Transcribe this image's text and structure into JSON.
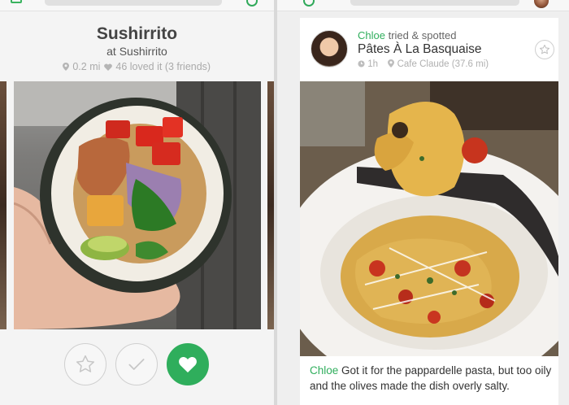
{
  "left_card": {
    "place_name": "Sushirrito",
    "place_sub": "at Sushirrito",
    "distance": "0.2 mi",
    "loved": "46 loved it (3 friends)"
  },
  "right_card": {
    "user": "Chloe",
    "action": "tried & spotted",
    "dish": "Pâtes À La Basquaise",
    "time": "1h",
    "location": "Cafe Claude (37.6 mi)",
    "comment_user": "Chloe",
    "comment_text": "Got it for the pappardelle pasta, but too oily and the olives made the dish overly salty."
  },
  "icons": {
    "star": "star-icon",
    "check": "check-icon",
    "heart": "heart-icon",
    "pin": "pin-icon",
    "clock": "clock-icon"
  },
  "colors": {
    "brand_green": "#2fae5c",
    "muted_text": "#aaaaaa"
  }
}
